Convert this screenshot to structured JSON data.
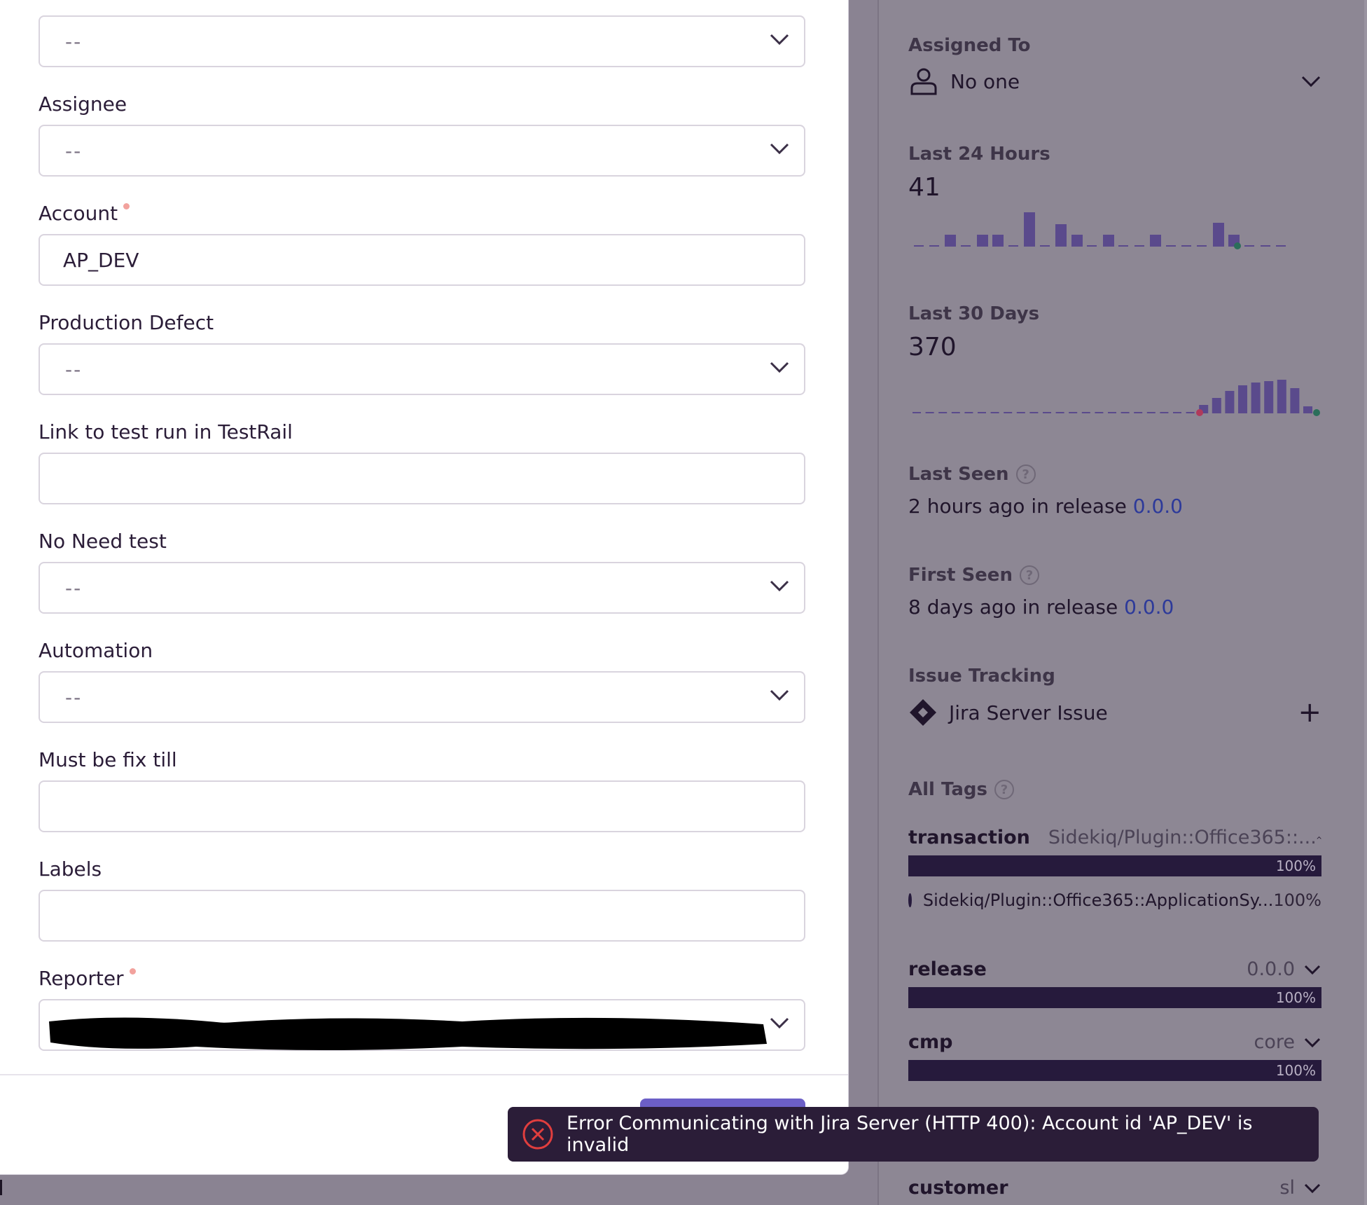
{
  "form": {
    "fields": [
      {
        "label": "",
        "value": "--",
        "type": "select"
      },
      {
        "label": "Assignee",
        "value": "--",
        "type": "select"
      },
      {
        "label": "Account",
        "value": "AP_DEV",
        "type": "text",
        "required": true
      },
      {
        "label": "Production Defect",
        "value": "--",
        "type": "select"
      },
      {
        "label": "Link to test run in TestRail",
        "value": "",
        "type": "text"
      },
      {
        "label": "No Need test",
        "value": "--",
        "type": "select"
      },
      {
        "label": "Automation",
        "value": "--",
        "type": "select"
      },
      {
        "label": "Must be fix till",
        "value": "",
        "type": "text"
      },
      {
        "label": "Labels",
        "value": "",
        "type": "text"
      },
      {
        "label": "Reporter",
        "value": "",
        "type": "select",
        "required": true
      }
    ]
  },
  "sidebar": {
    "assigned_to": {
      "title": "Assigned To",
      "value": "No one"
    },
    "last_24h": {
      "title": "Last 24 Hours",
      "count": "41"
    },
    "last_30d": {
      "title": "Last 30 Days",
      "count": "370"
    },
    "last_seen": {
      "title": "Last Seen",
      "ago": "2 hours ago",
      "in_release": "in release",
      "release": "0.0.0"
    },
    "first_seen": {
      "title": "First Seen",
      "ago": "8 days ago",
      "in_release": "in release",
      "release": "0.0.0"
    },
    "issue_tracking": {
      "title": "Issue Tracking",
      "item": "Jira Server Issue"
    },
    "all_tags": {
      "title": "All Tags",
      "tags": [
        {
          "key": "transaction",
          "value": "Sidekiq/Plugin::Office365::...",
          "pct": "100%",
          "sub_value": "Sidekiq/Plugin::Office365::ApplicationSy...",
          "sub_pct": "100%"
        },
        {
          "key": "release",
          "value": "0.0.0",
          "pct": "100%"
        },
        {
          "key": "cmp",
          "value": "core",
          "pct": "100%"
        },
        {
          "key": "customer",
          "value": "sl"
        }
      ]
    }
  },
  "toast": {
    "message": "Error Communicating with Jira Server (HTTP 400): Account id 'AP_DEV' is invalid"
  },
  "colors": {
    "accent": "#6c5fc7",
    "bar": "#261a3c",
    "error": "#e03e3e",
    "spark": "#5a4a8c"
  }
}
